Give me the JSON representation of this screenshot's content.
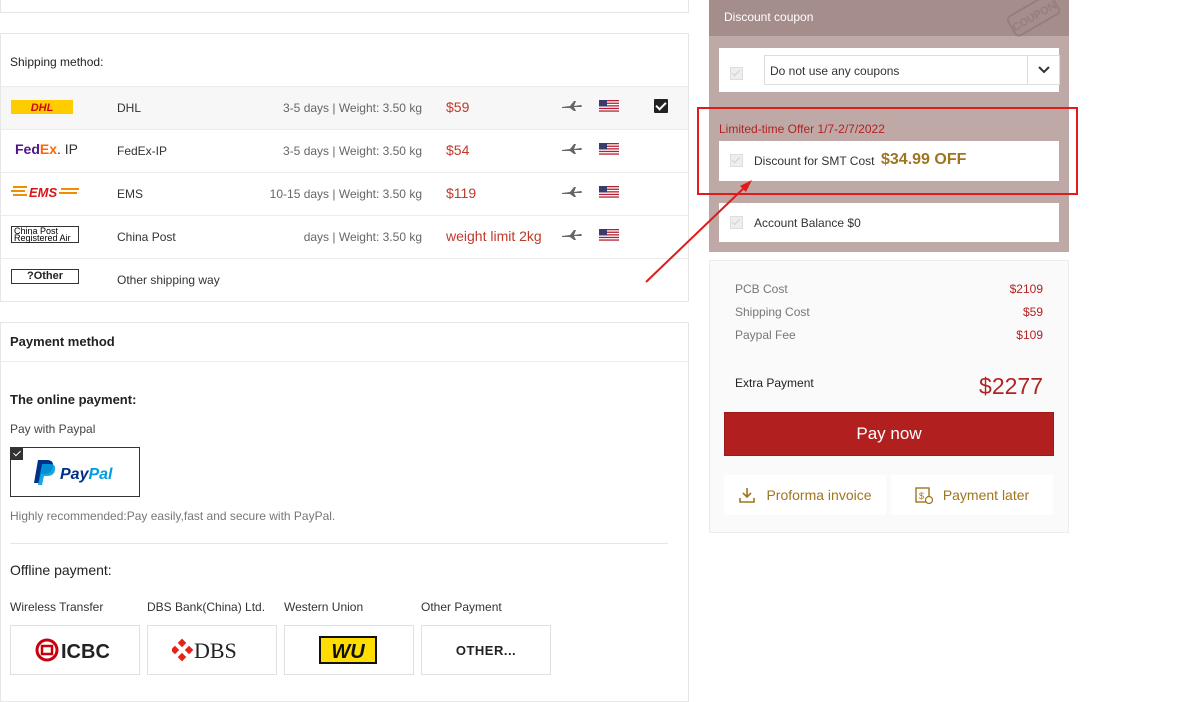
{
  "shipping": {
    "title": "Shipping method:",
    "rows": [
      {
        "logo": "DHL",
        "name": "DHL",
        "days": "3-5 days | Weight: 3.50 kg",
        "price": "$59",
        "selected": true
      },
      {
        "logo": "FedEx. IP",
        "name": "FedEx-IP",
        "days": "3-5 days | Weight: 3.50 kg",
        "price": "$54",
        "selected": false
      },
      {
        "logo": "EMS",
        "name": "EMS",
        "days": "10-15 days | Weight: 3.50 kg",
        "price": "$119",
        "selected": false
      },
      {
        "logo": "China Post Registered Air",
        "name": "China Post",
        "days": "days | Weight: 3.50 kg",
        "price": "weight limit 2kg",
        "selected": false
      },
      {
        "logo": "?Other",
        "name": "Other shipping way",
        "days": "",
        "price": "",
        "selected": false
      }
    ]
  },
  "payment": {
    "title": "Payment method",
    "online_heading": "The online payment:",
    "pay_with": "Pay with Paypal",
    "paypal_logo": "PayPal",
    "recommend": "Highly recommended:Pay easily,fast and secure with PayPal.",
    "offline_heading": "Offline payment:",
    "offline": [
      {
        "label": "Wireless Transfer",
        "logo": "ICBC"
      },
      {
        "label": "DBS Bank(China) Ltd.",
        "logo": "DBS"
      },
      {
        "label": "Western Union",
        "logo": "WU"
      },
      {
        "label": "Other Payment",
        "logo": "OTHER..."
      }
    ]
  },
  "coupon": {
    "header": "Discount coupon",
    "stamp": "COUPON",
    "select_value": "Do not use any coupons",
    "limited_offer": "Limited-time Offer 1/7-2/7/2022",
    "smt_label": "Discount for SMT Cost",
    "smt_amount": "$34.99 OFF",
    "balance_label": "Account Balance $0"
  },
  "summary": {
    "pcb_label": "PCB Cost",
    "pcb_value": "$2109",
    "shipping_label": "Shipping Cost",
    "shipping_value": "$59",
    "paypal_label": "Paypal Fee",
    "paypal_value": "$109",
    "extra_label": "Extra Payment",
    "extra_value": "$2277",
    "pay_now": "Pay now",
    "proforma": "Proforma invoice",
    "pay_later": "Payment later"
  },
  "colors": {
    "accent_red": "#b21f1f",
    "coupon_bg": "#bfa9a7",
    "gold": "#a0751f"
  }
}
